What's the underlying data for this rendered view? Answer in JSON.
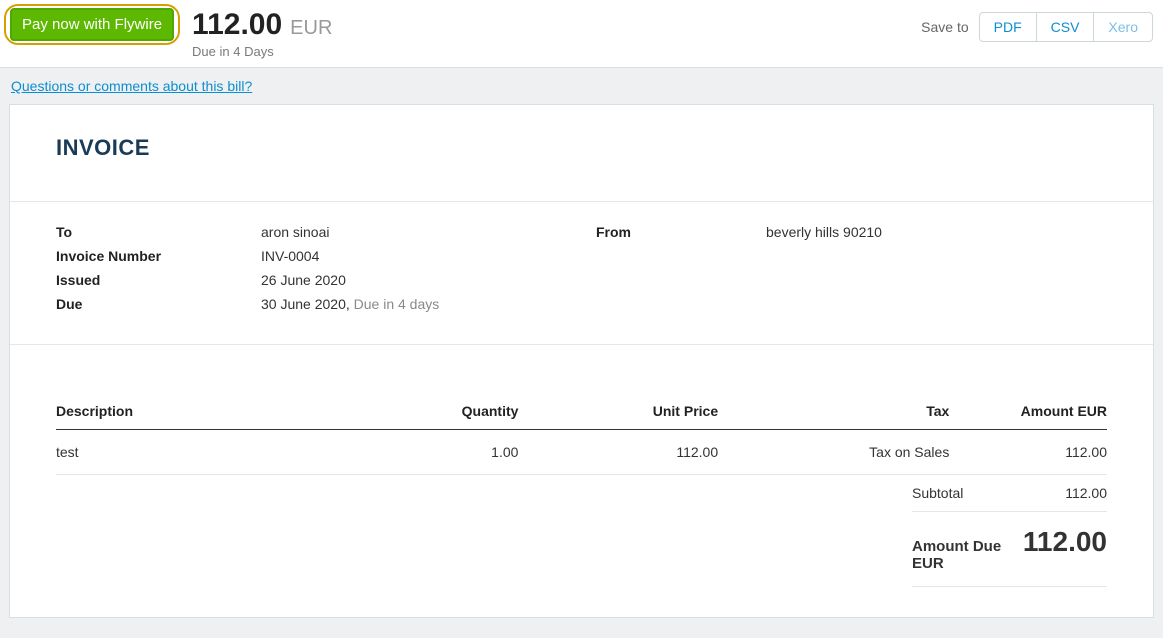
{
  "topbar": {
    "pay_button": "Pay now with Flywire",
    "amount": "112.00",
    "currency": "EUR",
    "due_text": "Due in 4 Days",
    "save_to": "Save to",
    "buttons": {
      "pdf": "PDF",
      "csv": "CSV",
      "xero": "Xero"
    }
  },
  "questions_link": "Questions or comments about this bill?",
  "invoice": {
    "title": "INVOICE",
    "labels": {
      "to": "To",
      "invoice_number": "Invoice Number",
      "issued": "Issued",
      "due": "Due",
      "from": "From"
    },
    "to": "aron sinoai",
    "invoice_number": "INV-0004",
    "issued": "26 June 2020",
    "due_date": "30 June 2020,",
    "due_relative": "Due in 4 days",
    "from": "beverly hills 90210"
  },
  "table": {
    "headers": {
      "description": "Description",
      "quantity": "Quantity",
      "unit_price": "Unit Price",
      "tax": "Tax",
      "amount": "Amount EUR"
    },
    "row": {
      "description": "test",
      "quantity": "1.00",
      "unit_price": "112.00",
      "tax": "Tax on Sales",
      "amount": "112.00"
    }
  },
  "totals": {
    "subtotal_label": "Subtotal",
    "subtotal_value": "112.00",
    "amount_due_label": "Amount Due EUR",
    "amount_due_value": "112.00"
  }
}
